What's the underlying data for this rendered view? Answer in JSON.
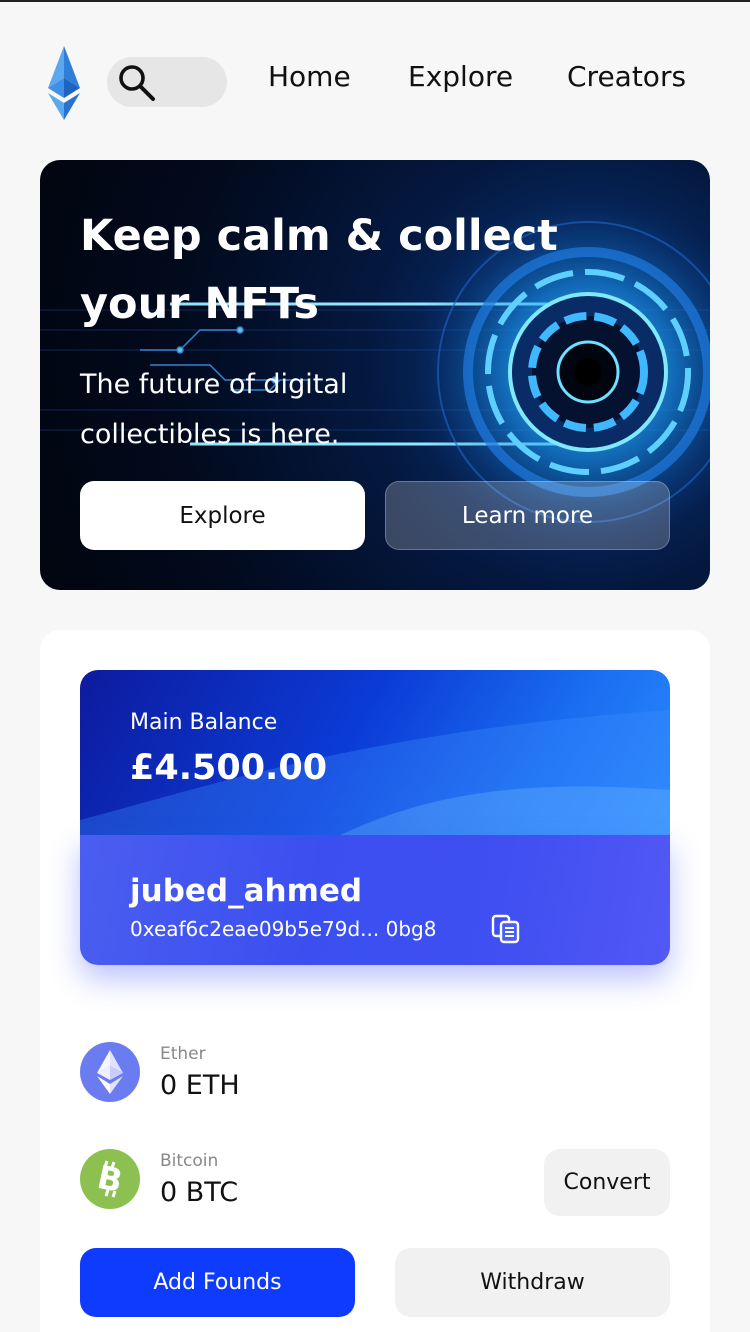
{
  "nav": {
    "links": [
      "Home",
      "Explore",
      "Creators"
    ]
  },
  "hero": {
    "title": "Keep calm & collect your NFTs",
    "subtitle": "The future of digital collectibles is here.",
    "explore_label": "Explore",
    "learn_more_label": "Learn more"
  },
  "wallet": {
    "balance_label": "Main Balance",
    "balance_value": "£4.500.00",
    "account_name": "jubed_ahmed",
    "account_address": "0xeaf6c2eae09b5e79d... 0bg8",
    "coins": [
      {
        "name": "Ether",
        "amount": "0 ETH",
        "icon": "ethereum-icon",
        "color": "#6b7cf0"
      },
      {
        "name": "Bitcoin",
        "amount": "0 BTC",
        "icon": "bitcoin-icon",
        "color": "#8cc152"
      }
    ],
    "convert_label": "Convert",
    "add_label": "Add Founds",
    "withdraw_label": "Withdraw"
  },
  "colors": {
    "primary": "#0f3bff",
    "background": "#f7f7f7"
  }
}
